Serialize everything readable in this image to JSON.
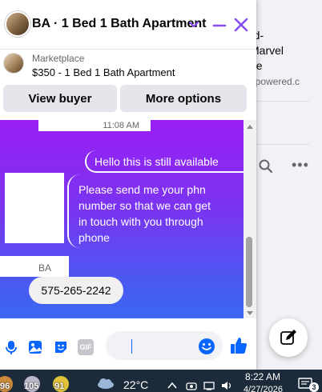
{
  "background_page": {
    "lines": [
      "rd-",
      "Marvel",
      "ne"
    ],
    "muted_line": "npowered.c"
  },
  "chat": {
    "title": "BA · 1 Bed 1 Bath Apartment",
    "listing": {
      "label": "Marketplace",
      "title": "$350 - 1 Bed 1 Bath Apartment"
    },
    "buttons": {
      "view_buyer": "View buyer",
      "more_options": "More options"
    },
    "messages": {
      "timestamp": "11:08 AM",
      "sent_1": "Hello this is still available",
      "sent_2": "Please send me your phn number so that we can get in touch with you through phone",
      "sender_name": "BA",
      "received_1": "575-265-2242"
    },
    "composer": {
      "gif_label": "GIF",
      "input_value": ""
    },
    "colors": {
      "accent": "#8a4cf0",
      "thumbs": "#0866ff",
      "gradient_top": "#9a1ff5",
      "gradient_bottom": "#3b66f3"
    }
  },
  "taskbar": {
    "apps": [
      {
        "icon": "app-badge-icon",
        "badge": "96"
      },
      {
        "icon": "app-badge-icon",
        "badge": "105"
      },
      {
        "icon": "app-badge-icon",
        "badge": "91"
      }
    ],
    "weather": {
      "icon": "cloud-icon",
      "temp": "22°C"
    },
    "time": "8:22 AM",
    "date": "4/27/2026",
    "notification_count": "3"
  }
}
